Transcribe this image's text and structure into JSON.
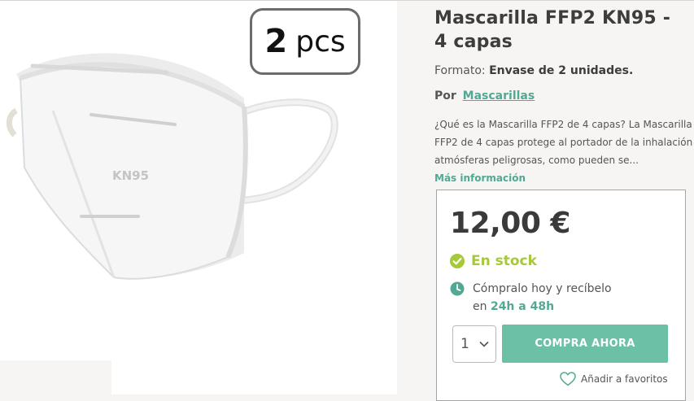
{
  "image": {
    "badge_number": "2",
    "badge_unit": "pcs",
    "mask_imprint": "KN95"
  },
  "product": {
    "title": "Mascarilla FFP2 KN95 - 4 capas",
    "format_label": "Formato:",
    "format_value": "Envase de 2 unidades.",
    "by_label": "Por",
    "brand": "Mascarillas",
    "description": "¿Qué es la Mascarilla FFP2 de 4 capas? La Mascarilla FFP2 de 4 capas protege al portador de la inhalación atmósferas peligrosas, como pueden se...",
    "more_link": "Más información"
  },
  "purchase": {
    "price": "12,00 €",
    "stock_status": "En stock",
    "shipping_line1": "Cómpralo hoy y recíbelo",
    "shipping_prefix": "en",
    "shipping_time": "24h a 48h",
    "quantity": "1",
    "buy_button": "COMPRA AHORA",
    "favorites_link": "Añadir a favoritos"
  },
  "colors": {
    "accent_green": "#6cc0a6",
    "link_green": "#52a893",
    "stock_green": "#a7c83a"
  }
}
